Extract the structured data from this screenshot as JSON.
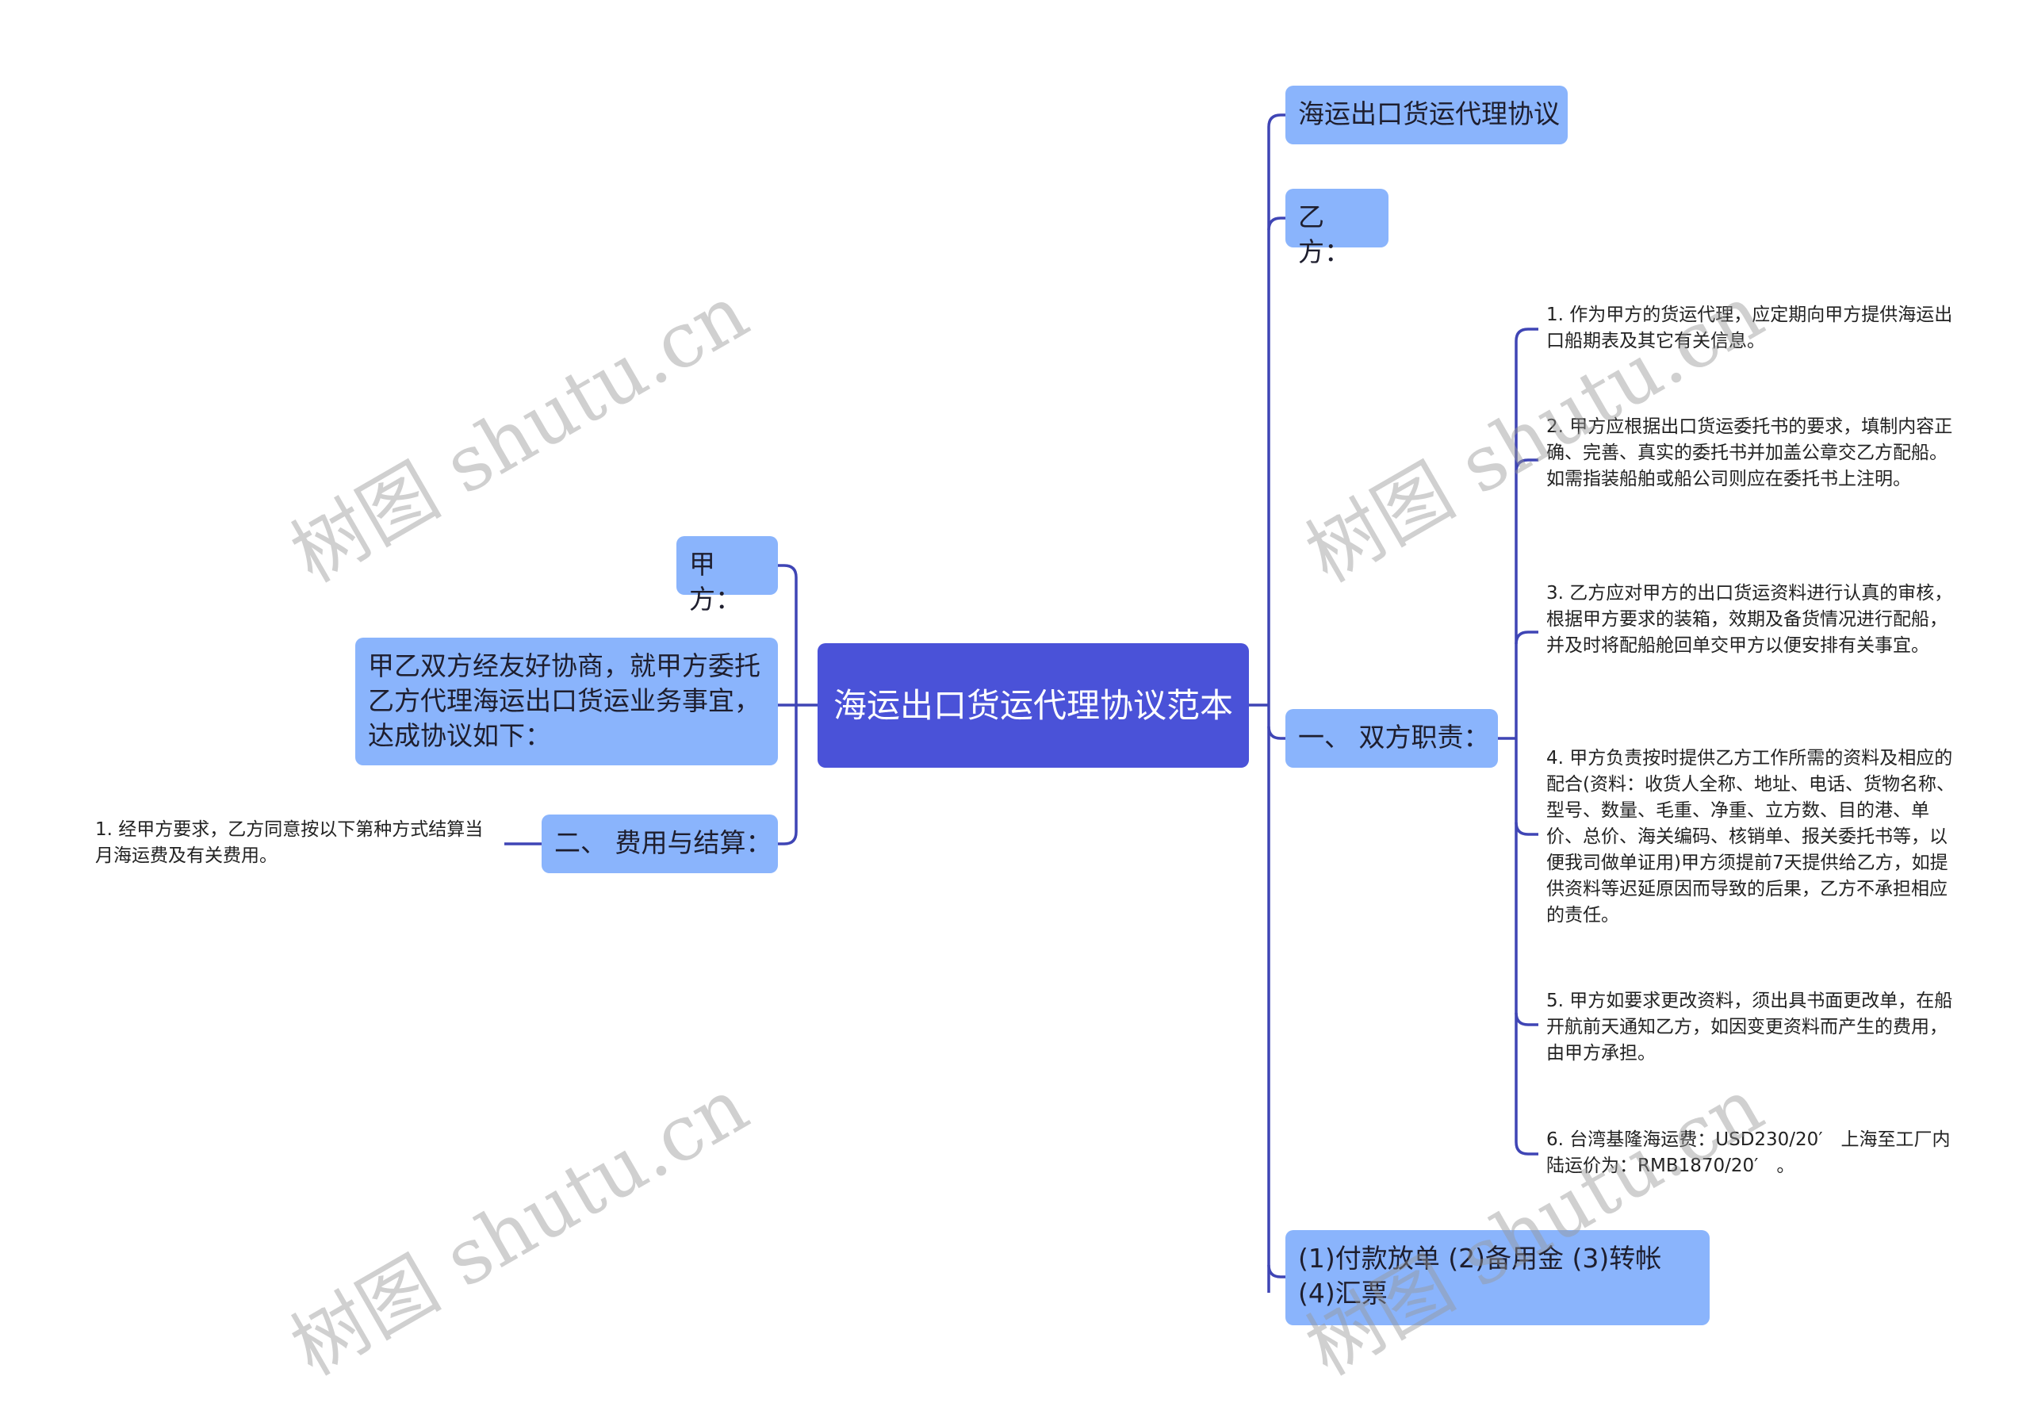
{
  "root": {
    "label": "海运出口货运代理协议范本"
  },
  "left": {
    "party_a": "甲方：",
    "intro": "甲乙双方经友好协商，就甲方委托乙方代理海运出口货运业务事宜，达成协议如下：",
    "fees": "二、 费用与结算：",
    "fees_leaf": "1. 经甲方要求，乙方同意按以下第种方式结算当月海运费及有关费用。"
  },
  "right": {
    "title": "海运出口货运代理协议",
    "party_b": "乙方：",
    "duties": "一、 双方职责：",
    "payment": "(1)付款放单 (2)备用金 (3)转帐(4)汇票",
    "duty_items": [
      "1. 作为甲方的货运代理，应定期向甲方提供海运出口船期表及其它有关信息。",
      "2. 甲方应根据出口货运委托书的要求，填制内容正确、完善、真实的委托书并加盖公章交乙方配船。如需指装船舶或船公司则应在委托书上注明。",
      "3. 乙方应对甲方的出口货运资料进行认真的审核，根据甲方要求的装箱，效期及备货情况进行配船，并及时将配船舱回单交甲方以便安排有关事宜。",
      "4. 甲方负责按时提供乙方工作所需的资料及相应的配合(资料：收货人全称、地址、电话、货物名称、型号、数量、毛重、净重、立方数、目的港、单价、总价、海关编码、核销单、报关委托书等，以便我司做单证用)甲方须提前7天提供给乙方，如提供资料等迟延原因而导致的后果，乙方不承担相应的责任。",
      "5. 甲方如要求更改资料，须出具书面更改单，在船开航前天通知乙方，如因变更资料而产生的费用，由甲方承担。",
      "6. 台湾基隆海运费：USD230/20′　上海至工厂内陆运价为：RMB1870/20′　。"
    ]
  },
  "watermark": "树图 shutu.cn",
  "colors": {
    "root": "#4a52d8",
    "node": "#8ab4fc",
    "line": "#3f45b5"
  }
}
